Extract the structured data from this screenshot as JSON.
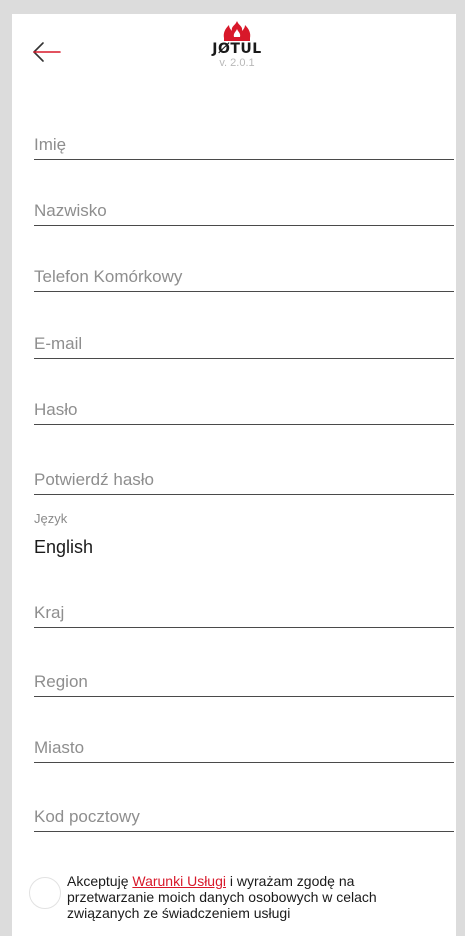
{
  "header": {
    "back_icon": "back-arrow-icon",
    "logo_text": "JØTUL",
    "logo_icon": "flame-icon",
    "version": "v. 2.0.1",
    "accent_color": "#d8182a"
  },
  "form": {
    "first_name": {
      "placeholder": "Imię",
      "value": ""
    },
    "last_name": {
      "placeholder": "Nazwisko",
      "value": ""
    },
    "mobile_phone": {
      "placeholder": "Telefon Komórkowy",
      "value": ""
    },
    "email": {
      "placeholder": "E-mail",
      "value": ""
    },
    "password": {
      "placeholder": "Hasło",
      "value": ""
    },
    "confirm_password": {
      "placeholder": "Potwierdź hasło",
      "value": ""
    },
    "language": {
      "label": "Język",
      "value": "English"
    },
    "country": {
      "placeholder": "Kraj",
      "value": ""
    },
    "region": {
      "placeholder": "Region",
      "value": ""
    },
    "city": {
      "placeholder": "Miasto",
      "value": ""
    },
    "postal_code": {
      "placeholder": "Kod pocztowy",
      "value": ""
    }
  },
  "consent": {
    "checked": false,
    "text_before": "Akceptuję ",
    "terms_link": "Warunki Usługi",
    "text_after": " i wyrażam zgodę na przetwarzanie moich danych osobowych w celach związanych ze świadczeniem usługi"
  }
}
